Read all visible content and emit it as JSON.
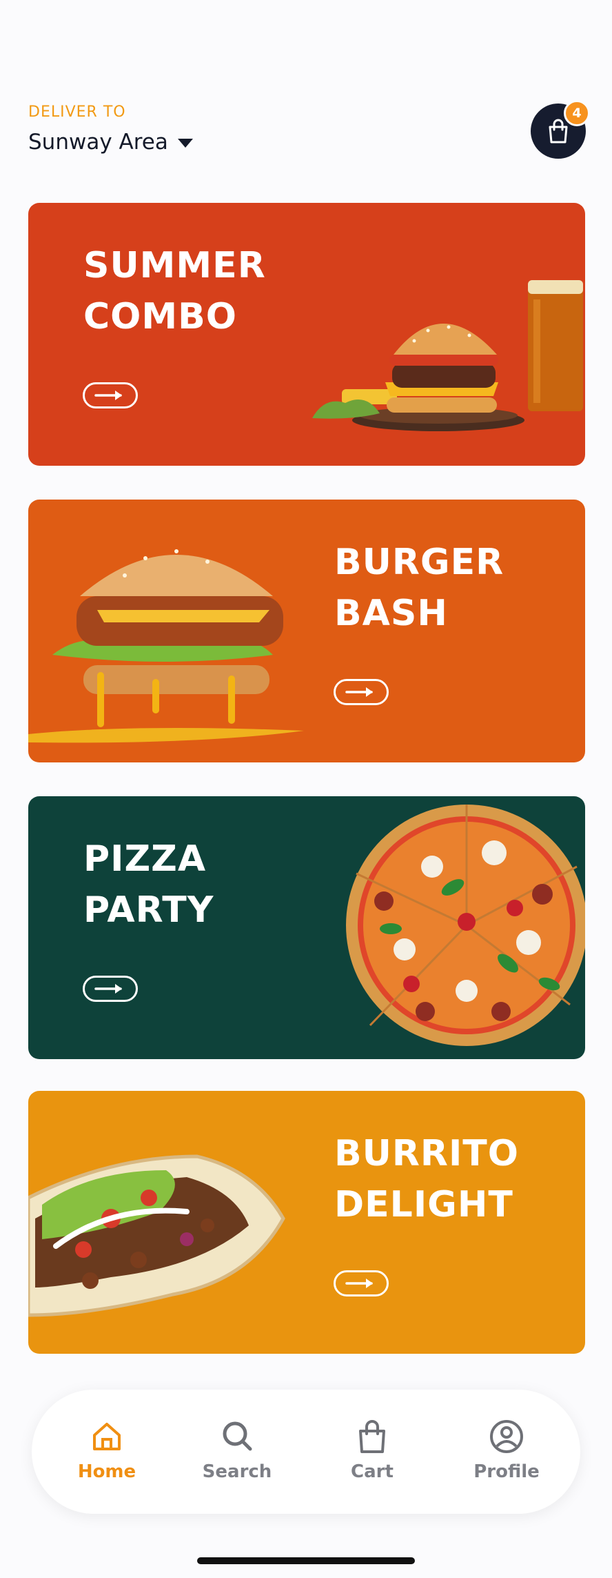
{
  "header": {
    "deliver_label": "DELIVER TO",
    "location": "Sunway Area",
    "cart_badge": "4"
  },
  "colors": {
    "accent": "#F7921E",
    "dark": "#161C2F",
    "card_summer": "#D6401B",
    "card_burger": "#DF5C14",
    "card_pizza": "#0E423A",
    "card_burrito": "#E9940F"
  },
  "cards": [
    {
      "line1": "SUMMER",
      "line2": "COMBO",
      "image": "burger-and-beer"
    },
    {
      "line1": "BURGER",
      "line2": "BASH",
      "image": "cheese-burger"
    },
    {
      "line1": "PIZZA",
      "line2": "PARTY",
      "image": "pizza"
    },
    {
      "line1": "BURRITO",
      "line2": "DELIGHT",
      "image": "burrito"
    }
  ],
  "nav": {
    "items": [
      {
        "label": "Home",
        "icon": "home-icon",
        "active": true
      },
      {
        "label": "Search",
        "icon": "search-icon",
        "active": false
      },
      {
        "label": "Cart",
        "icon": "bag-icon",
        "active": false
      },
      {
        "label": "Profile",
        "icon": "profile-icon",
        "active": false
      }
    ]
  }
}
